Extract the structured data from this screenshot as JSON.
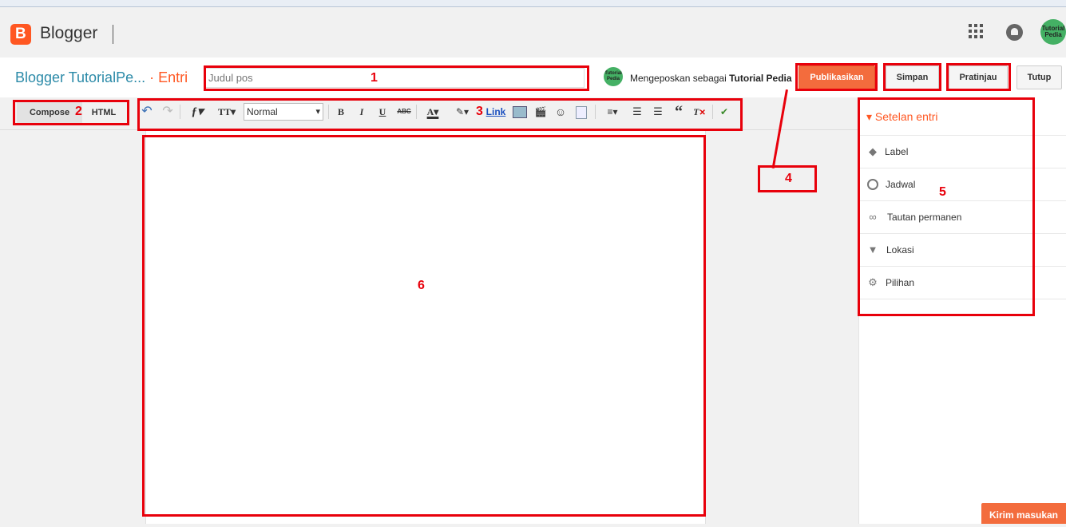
{
  "header": {
    "brand": "Blogger",
    "logo_letter": "B",
    "avatar_text_1": "Tutorial",
    "avatar_text_2": "Pedia"
  },
  "post": {
    "blog_name": "Blogger TutorialPe...",
    "crumb": "Entri",
    "title_placeholder": "Judul pos",
    "posting_as_prefix": "Mengeposkan sebagai",
    "posting_as_user": "Tutorial Pedia",
    "publish_label": "Publikasikan",
    "save_label": "Simpan",
    "preview_label": "Pratinjau",
    "close_label": "Tutup"
  },
  "editor": {
    "compose_label": "Compose",
    "html_label": "HTML",
    "format_value": "Normal",
    "link_label": "Link"
  },
  "sidebar": {
    "header": "Setelan entri",
    "items": [
      {
        "label": "Label",
        "icon": "tag-icon"
      },
      {
        "label": "Jadwal",
        "icon": "clock-icon"
      },
      {
        "label": "Tautan permanen",
        "icon": "link-icon"
      },
      {
        "label": "Lokasi",
        "icon": "location-pin-icon"
      },
      {
        "label": "Pilihan",
        "icon": "gear-icon"
      }
    ]
  },
  "feedback_label": "Kirim masukan",
  "annotations": [
    "1",
    "2",
    "3",
    "4",
    "5",
    "6"
  ],
  "colors": {
    "accent": "#ff5722",
    "publish": "#f36c3d",
    "blog_name": "#2b8aa8",
    "annotation": "#e8000b"
  }
}
